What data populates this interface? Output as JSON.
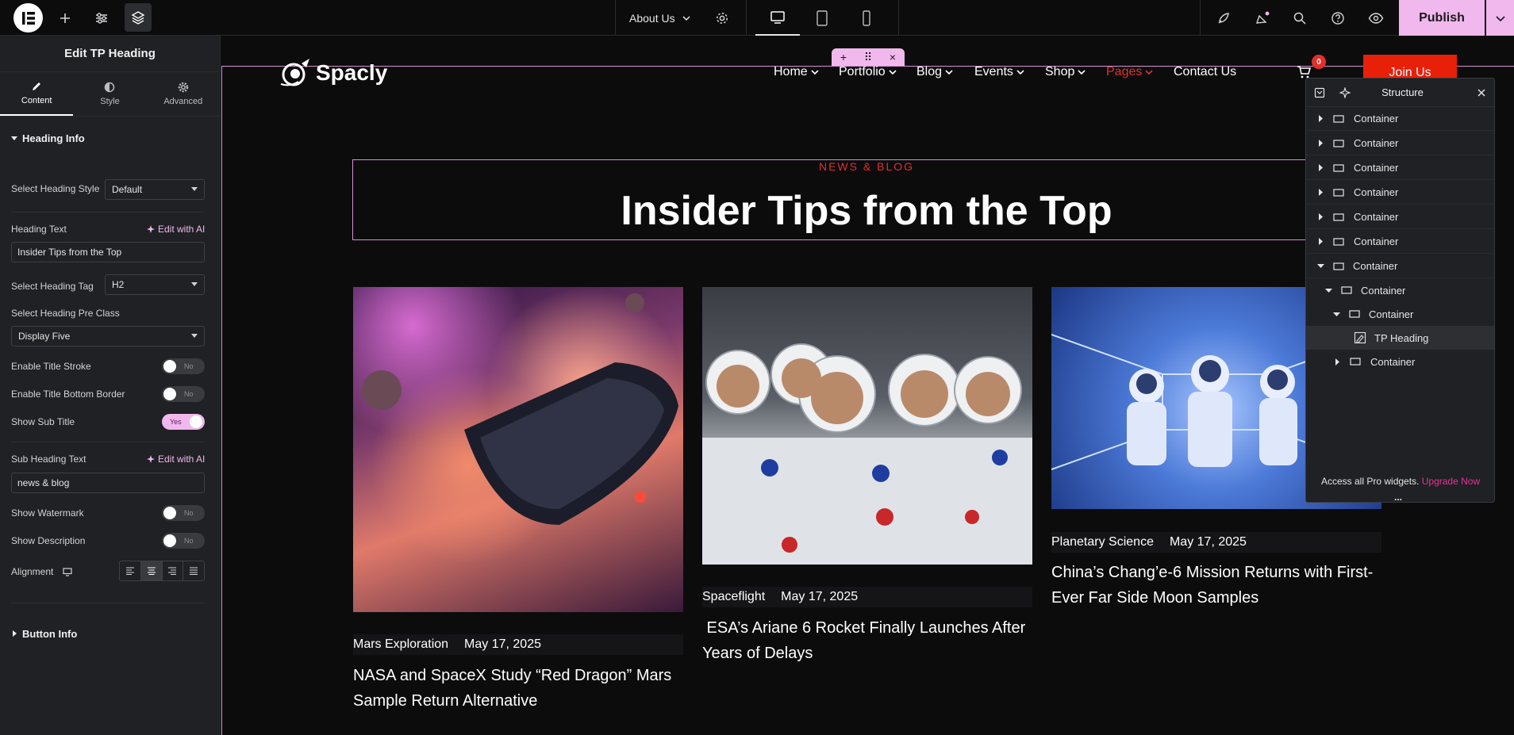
{
  "topbar": {
    "page_selector": "About Us",
    "publish_label": "Publish"
  },
  "panel": {
    "title": "Edit TP Heading",
    "tabs": [
      {
        "label": "Content",
        "icon": "pencil-icon"
      },
      {
        "label": "Style",
        "icon": "half-circle-icon"
      },
      {
        "label": "Advanced",
        "icon": "gear-icon"
      }
    ],
    "section_heading_info": "Heading Info",
    "select_heading_style_label": "Select Heading Style",
    "select_heading_style_value": "Default",
    "heading_text_label": "Heading Text",
    "edit_with_ai": "Edit with AI",
    "heading_text_value": "Insider Tips from the Top",
    "select_heading_tag_label": "Select Heading Tag",
    "select_heading_tag_value": "H2",
    "select_heading_pre_class_label": "Select Heading Pre Class",
    "select_heading_pre_class_value": "Display Five",
    "enable_title_stroke_label": "Enable Title Stroke",
    "enable_title_bottom_border_label": "Enable Title Bottom Border",
    "show_sub_title_label": "Show Sub Title",
    "sub_heading_text_label": "Sub Heading Text",
    "sub_heading_text_value": "news & blog",
    "show_watermark_label": "Show Watermark",
    "show_description_label": "Show Description",
    "alignment_label": "Alignment",
    "toggle_no": "No",
    "toggle_yes": "Yes",
    "section_button_info": "Button Info"
  },
  "site": {
    "brand": "Spacly",
    "nav": [
      {
        "label": "Home",
        "active": false
      },
      {
        "label": "Portfolio",
        "active": false
      },
      {
        "label": "Blog",
        "active": false
      },
      {
        "label": "Events",
        "active": false
      },
      {
        "label": "Shop",
        "active": false
      },
      {
        "label": "Pages",
        "active": true
      },
      {
        "label": "Contact Us",
        "active": false
      }
    ],
    "cart_count": "0",
    "join_label": "Join Us",
    "subheading": "NEWS & BLOG",
    "heading": "Insider Tips from the Top",
    "posts": [
      {
        "category": "Mars Exploration",
        "date": "May 17, 2025",
        "title_line1": "NASA and SpaceX Study “Red Dragon” Mars",
        "title_line2": "Sample Return Alternative"
      },
      {
        "category": "Spaceflight",
        "date": "May 17, 2025",
        "title_line1": " ESA’s Ariane 6 Rocket Finally Launches After",
        "title_line2": "Years of Delays"
      },
      {
        "category": "Planetary Science",
        "date": "May 17, 2025",
        "title_line1": "China’s Chang’e-6 Mission Returns with First-",
        "title_line2": "Ever Far Side Moon Samples"
      }
    ]
  },
  "structure": {
    "title": "Structure",
    "rows": [
      "Container",
      "Container",
      "Container",
      "Container",
      "Container",
      "Container",
      "Container",
      "Container",
      "Container",
      "TP Heading",
      "Container"
    ],
    "promo_text": "Access all Pro widgets.",
    "promo_link": "Upgrade Now",
    "more": "..."
  },
  "colors": {
    "accent_pink": "#f0b8ec",
    "brand_red": "#e0302c"
  }
}
